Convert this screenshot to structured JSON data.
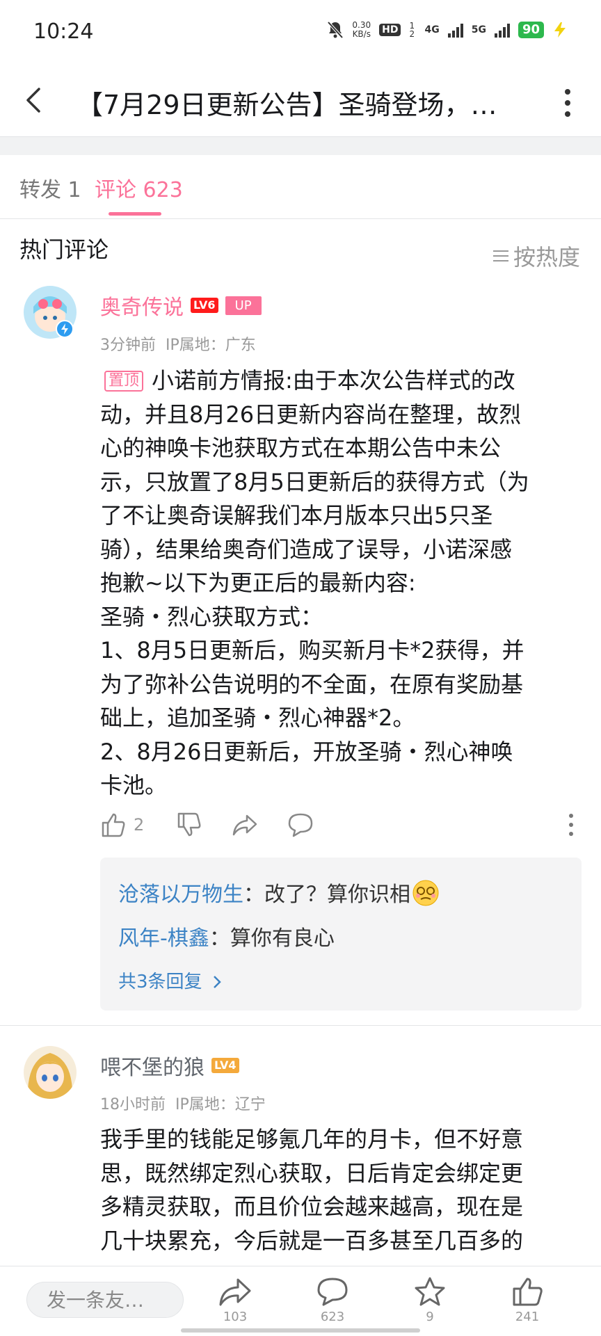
{
  "status_bar": {
    "time": "10:24",
    "speed_value": "0.30",
    "speed_unit": "KB/s",
    "hd": "HD",
    "sim": "1 2",
    "net1": "4G",
    "net2": "5G",
    "battery": "90"
  },
  "header": {
    "title": "【7月29日更新公告】圣骑登场，…"
  },
  "tabs": {
    "repost": "转发 1",
    "comment": "评论 623"
  },
  "section": {
    "title": "热门评论",
    "sort_label": "按热度"
  },
  "comments": [
    {
      "user": "奥奇传说",
      "level": "LV6",
      "badge": "UP",
      "time": "3分钟前",
      "ip": "IP属地：广东",
      "pin_label": "置顶",
      "text_lines": [
        "小诺前方情报:由于本次公告样式的改",
        "动，并且8月26日更新内容尚在整理，故烈",
        "心的神唤卡池获取方式在本期公告中未公",
        "示，只放置了8月5日更新后的获得方式（为",
        "了不让奥奇误解我们本月版本只出5只圣",
        "骑），结果给奥奇们造成了误导，小诺深感",
        "抱歉~以下为更正后的最新内容:",
        "圣骑・烈心获取方式：",
        "1、8月5日更新后，购买新月卡*2获得，并",
        "为了弥补公告说明的不全面，在原有奖励基",
        "础上，追加圣骑・烈心神器*2。",
        "2、8月26日更新后，开放圣骑・烈心神唤",
        "卡池。"
      ],
      "likes": "2",
      "replies": [
        {
          "user": "沧落以万物生",
          "sep": "：",
          "text": "改了？算你识相"
        },
        {
          "user": "风年-棋鑫",
          "sep": "：",
          "text": "算你有良心"
        }
      ],
      "replies_more": "共3条回复"
    },
    {
      "user": "喂不堡的狼",
      "level": "LV4",
      "time": "18小时前",
      "ip": "IP属地：辽宁",
      "text_lines": [
        "我手里的钱能足够氪几年的月卡，但不好意",
        "思，既然绑定烈心获取，日后肯定会绑定更",
        "多精灵获取，而且价位会越来越高，现在是",
        "几十块累充，今后就是一百多甚至几百多的"
      ]
    }
  ],
  "bottom_bar": {
    "input_placeholder": "发一条友…",
    "share_count": "103",
    "comment_count": "623",
    "star_count": "9",
    "like_count": "241"
  },
  "colors": {
    "accent": "#fb7299",
    "link": "#3c83c5",
    "lv6": "#ff1b1b",
    "lv4": "#f4a93b"
  }
}
